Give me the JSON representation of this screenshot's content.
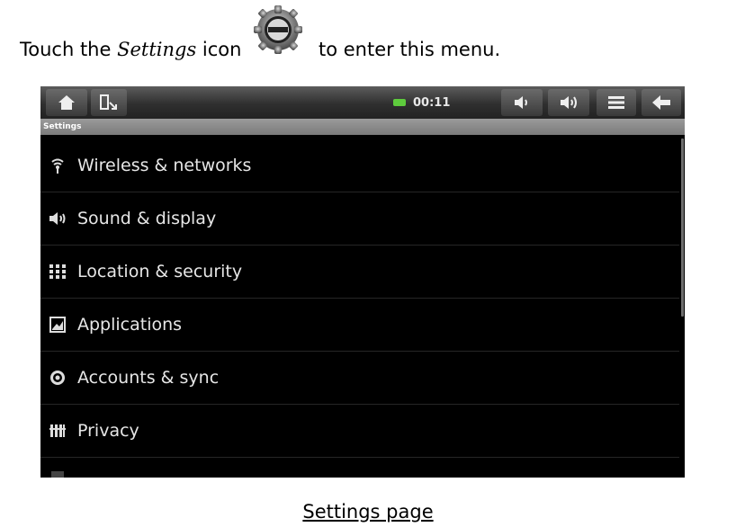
{
  "intro": {
    "part1": "Touch the ",
    "italic": "Settings",
    "part2": " icon",
    "part3": "to enter this menu."
  },
  "statusbar": {
    "time": "00:11",
    "battery_color": "#5ecb3d",
    "buttons": [
      "home-icon",
      "app-switch-icon",
      "volume-down-icon",
      "volume-up-icon",
      "menu-icon",
      "back-icon"
    ]
  },
  "screen": {
    "title": "Settings",
    "items": [
      {
        "label": "Wireless & networks",
        "icon": "wireless-icon"
      },
      {
        "label": "Sound & display",
        "icon": "speaker-icon"
      },
      {
        "label": "Location & security",
        "icon": "grid-icon"
      },
      {
        "label": "Applications",
        "icon": "applications-icon"
      },
      {
        "label": "Accounts & sync",
        "icon": "sync-icon"
      },
      {
        "label": "Privacy",
        "icon": "privacy-icon"
      }
    ]
  },
  "caption": "Settings page"
}
